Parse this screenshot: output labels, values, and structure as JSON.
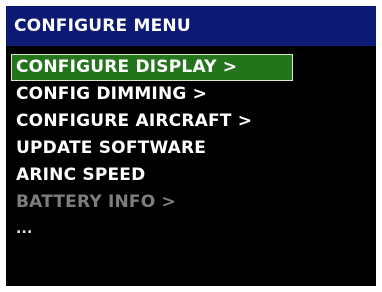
{
  "title": "CONFIGURE MENU",
  "menu": {
    "items": [
      {
        "label": "CONFIGURE DISPLAY >",
        "state": "selected"
      },
      {
        "label": "CONFIG DIMMING >",
        "state": "normal"
      },
      {
        "label": "CONFIGURE AIRCRAFT >",
        "state": "normal"
      },
      {
        "label": "UPDATE SOFTWARE",
        "state": "normal"
      },
      {
        "label": "ARINC SPEED",
        "state": "normal"
      },
      {
        "label": "BATTERY INFO >",
        "state": "disabled"
      },
      {
        "label": "...",
        "state": "more"
      }
    ]
  },
  "colors": {
    "title_bar": "#0c1a74",
    "selection": "#24741c",
    "background": "#000000",
    "text": "#ffffff",
    "disabled_text": "#7d7d7d"
  }
}
